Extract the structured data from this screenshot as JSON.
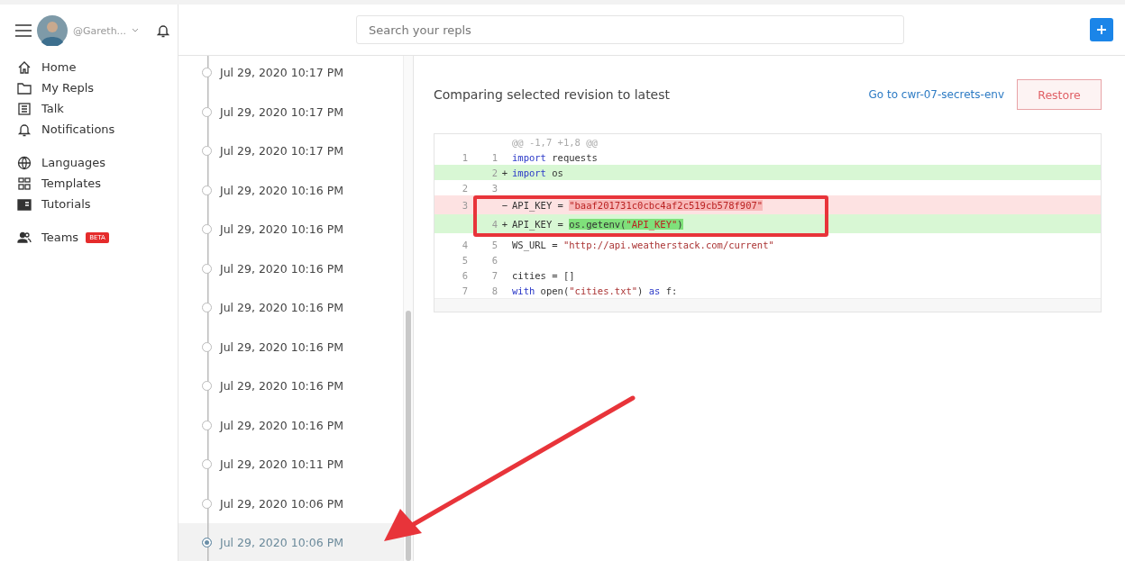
{
  "header": {
    "username": "@Gareth...",
    "search": {
      "placeholder": "Search your repls"
    }
  },
  "sidebar": {
    "groups": [
      [
        {
          "label": "Home",
          "kind": "home"
        },
        {
          "label": "My Repls",
          "kind": "folder"
        },
        {
          "label": "Talk",
          "kind": "talk"
        },
        {
          "label": "Notifications",
          "kind": "bell"
        }
      ],
      [
        {
          "label": "Languages",
          "kind": "globe"
        },
        {
          "label": "Templates",
          "kind": "templates"
        },
        {
          "label": "Tutorials",
          "kind": "book"
        }
      ],
      [
        {
          "label": "Teams",
          "kind": "team",
          "badge": "BETA"
        }
      ]
    ]
  },
  "revisions": [
    {
      "time": "Jul 29, 2020 10:17 PM",
      "selected": false
    },
    {
      "time": "Jul 29, 2020 10:17 PM",
      "selected": false
    },
    {
      "time": "Jul 29, 2020 10:17 PM",
      "selected": false
    },
    {
      "time": "Jul 29, 2020 10:16 PM",
      "selected": false
    },
    {
      "time": "Jul 29, 2020 10:16 PM",
      "selected": false
    },
    {
      "time": "Jul 29, 2020 10:16 PM",
      "selected": false
    },
    {
      "time": "Jul 29, 2020 10:16 PM",
      "selected": false
    },
    {
      "time": "Jul 29, 2020 10:16 PM",
      "selected": false
    },
    {
      "time": "Jul 29, 2020 10:16 PM",
      "selected": false
    },
    {
      "time": "Jul 29, 2020 10:16 PM",
      "selected": false
    },
    {
      "time": "Jul 29, 2020 10:11 PM",
      "selected": false
    },
    {
      "time": "Jul 29, 2020 10:06 PM",
      "selected": false
    },
    {
      "time": "Jul 29, 2020 10:06 PM",
      "selected": true
    }
  ],
  "compare": {
    "title": "Comparing selected revision to latest",
    "link": "Go to cwr-07-secrets-env",
    "restore": "Restore"
  },
  "diff": {
    "hunk": "@@ -1,7 +1,8 @@",
    "lines": [
      {
        "kind": "same",
        "old": "1",
        "new": "1",
        "highlighted": false,
        "tokens": [
          {
            "text": "import",
            "kind": "keyword"
          },
          {
            "text": " requests",
            "kind": "plain"
          }
        ]
      },
      {
        "kind": "add",
        "new": "2",
        "sign": "+",
        "highlighted": false,
        "tokens": [
          {
            "text": "import",
            "kind": "keyword"
          },
          {
            "text": " os",
            "kind": "plain"
          }
        ]
      },
      {
        "kind": "same",
        "old": "2",
        "new": "3",
        "highlighted": false
      },
      {
        "kind": "del",
        "old": "3",
        "sign": "−",
        "highlighted": true,
        "tokens": [
          {
            "text": "API_KEY = ",
            "kind": "plain"
          },
          {
            "text": "\"baaf201731c0cbc4af2c519cb578f907\"",
            "kind": "changed"
          }
        ]
      },
      {
        "kind": "add",
        "new": "4",
        "sign": "+",
        "highlighted": true,
        "tokens": [
          {
            "text": "API_KEY = ",
            "kind": "plain"
          },
          {
            "text": "os.getenv(",
            "kind": "changed"
          },
          {
            "text": "\"API_KEY\"",
            "kind": "changed-string"
          },
          {
            "text": ")",
            "kind": "changed"
          }
        ]
      },
      {
        "kind": "same",
        "old": "4",
        "new": "5",
        "highlighted": false,
        "tokens": [
          {
            "text": "WS_URL = ",
            "kind": "plain"
          },
          {
            "text": "\"http://api.weatherstack.com/current\"",
            "kind": "string"
          }
        ]
      },
      {
        "kind": "same",
        "old": "5",
        "new": "6",
        "highlighted": false
      },
      {
        "kind": "same",
        "old": "6",
        "new": "7",
        "highlighted": false,
        "tokens": [
          {
            "text": "cities = []",
            "kind": "plain"
          }
        ]
      },
      {
        "kind": "same",
        "old": "7",
        "new": "8",
        "highlighted": false,
        "tokens": [
          {
            "text": "with",
            "kind": "keyword"
          },
          {
            "text": " open(",
            "kind": "plain"
          },
          {
            "text": "\"cities.txt\"",
            "kind": "string"
          },
          {
            "text": ") ",
            "kind": "plain"
          },
          {
            "text": "as",
            "kind": "keyword"
          },
          {
            "text": " f:",
            "kind": "plain"
          }
        ]
      }
    ]
  }
}
